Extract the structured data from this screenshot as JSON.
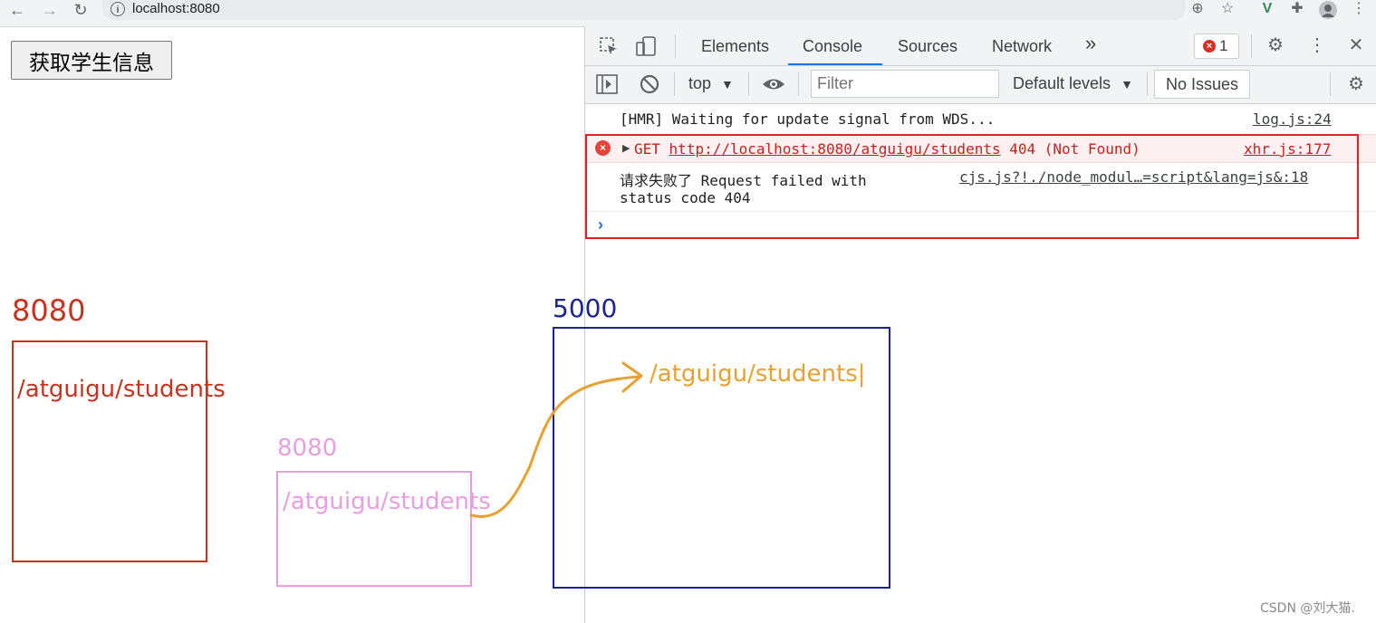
{
  "browser": {
    "url": "localhost:8080",
    "icons": {
      "back": "arrow-left-icon",
      "forward": "arrow-right-icon",
      "reload": "reload-icon",
      "info": "info-icon",
      "zoom": "zoom-icon",
      "bookmark": "star-icon",
      "vue": "vue-icon",
      "extensions": "puzzle-icon",
      "profile": "profile-icon",
      "menu": "kebab-menu-icon"
    }
  },
  "page": {
    "button_label": "获取学生信息"
  },
  "devtools": {
    "tabs": [
      "Elements",
      "Console",
      "Sources",
      "Network"
    ],
    "more_tabs": "»",
    "active_tab": "Console",
    "error_count": "1",
    "toolbar": {
      "context": "top",
      "filter_placeholder": "Filter",
      "levels": "Default levels",
      "issues": "No Issues"
    },
    "console": [
      {
        "message": "[HMR] Waiting for update signal from WDS...",
        "source": "log.js:24"
      },
      {
        "method": "GET",
        "url": "http://localhost:8080/atguigu/students",
        "status": "404 (Not Found)",
        "source": "xhr.js:177"
      },
      {
        "message_line1": "请求失败了 Request failed with",
        "message_line2": "status code 404",
        "source": "cjs.js?!./node_modul…=script&lang=js&:18"
      }
    ],
    "prompt": "›"
  },
  "annotations": {
    "left_port": "8080",
    "left_path": "/atguigu/students",
    "middle_port": "8080",
    "middle_path": "/atguigu/students",
    "right_port": "5000",
    "right_path": "/atguigu/students|",
    "colors": {
      "left": "#c8321e",
      "middle": "#e89ee0",
      "right": "#1c248e",
      "arrow": "#e8a030"
    }
  },
  "watermark": "CSDN @刘大猫."
}
